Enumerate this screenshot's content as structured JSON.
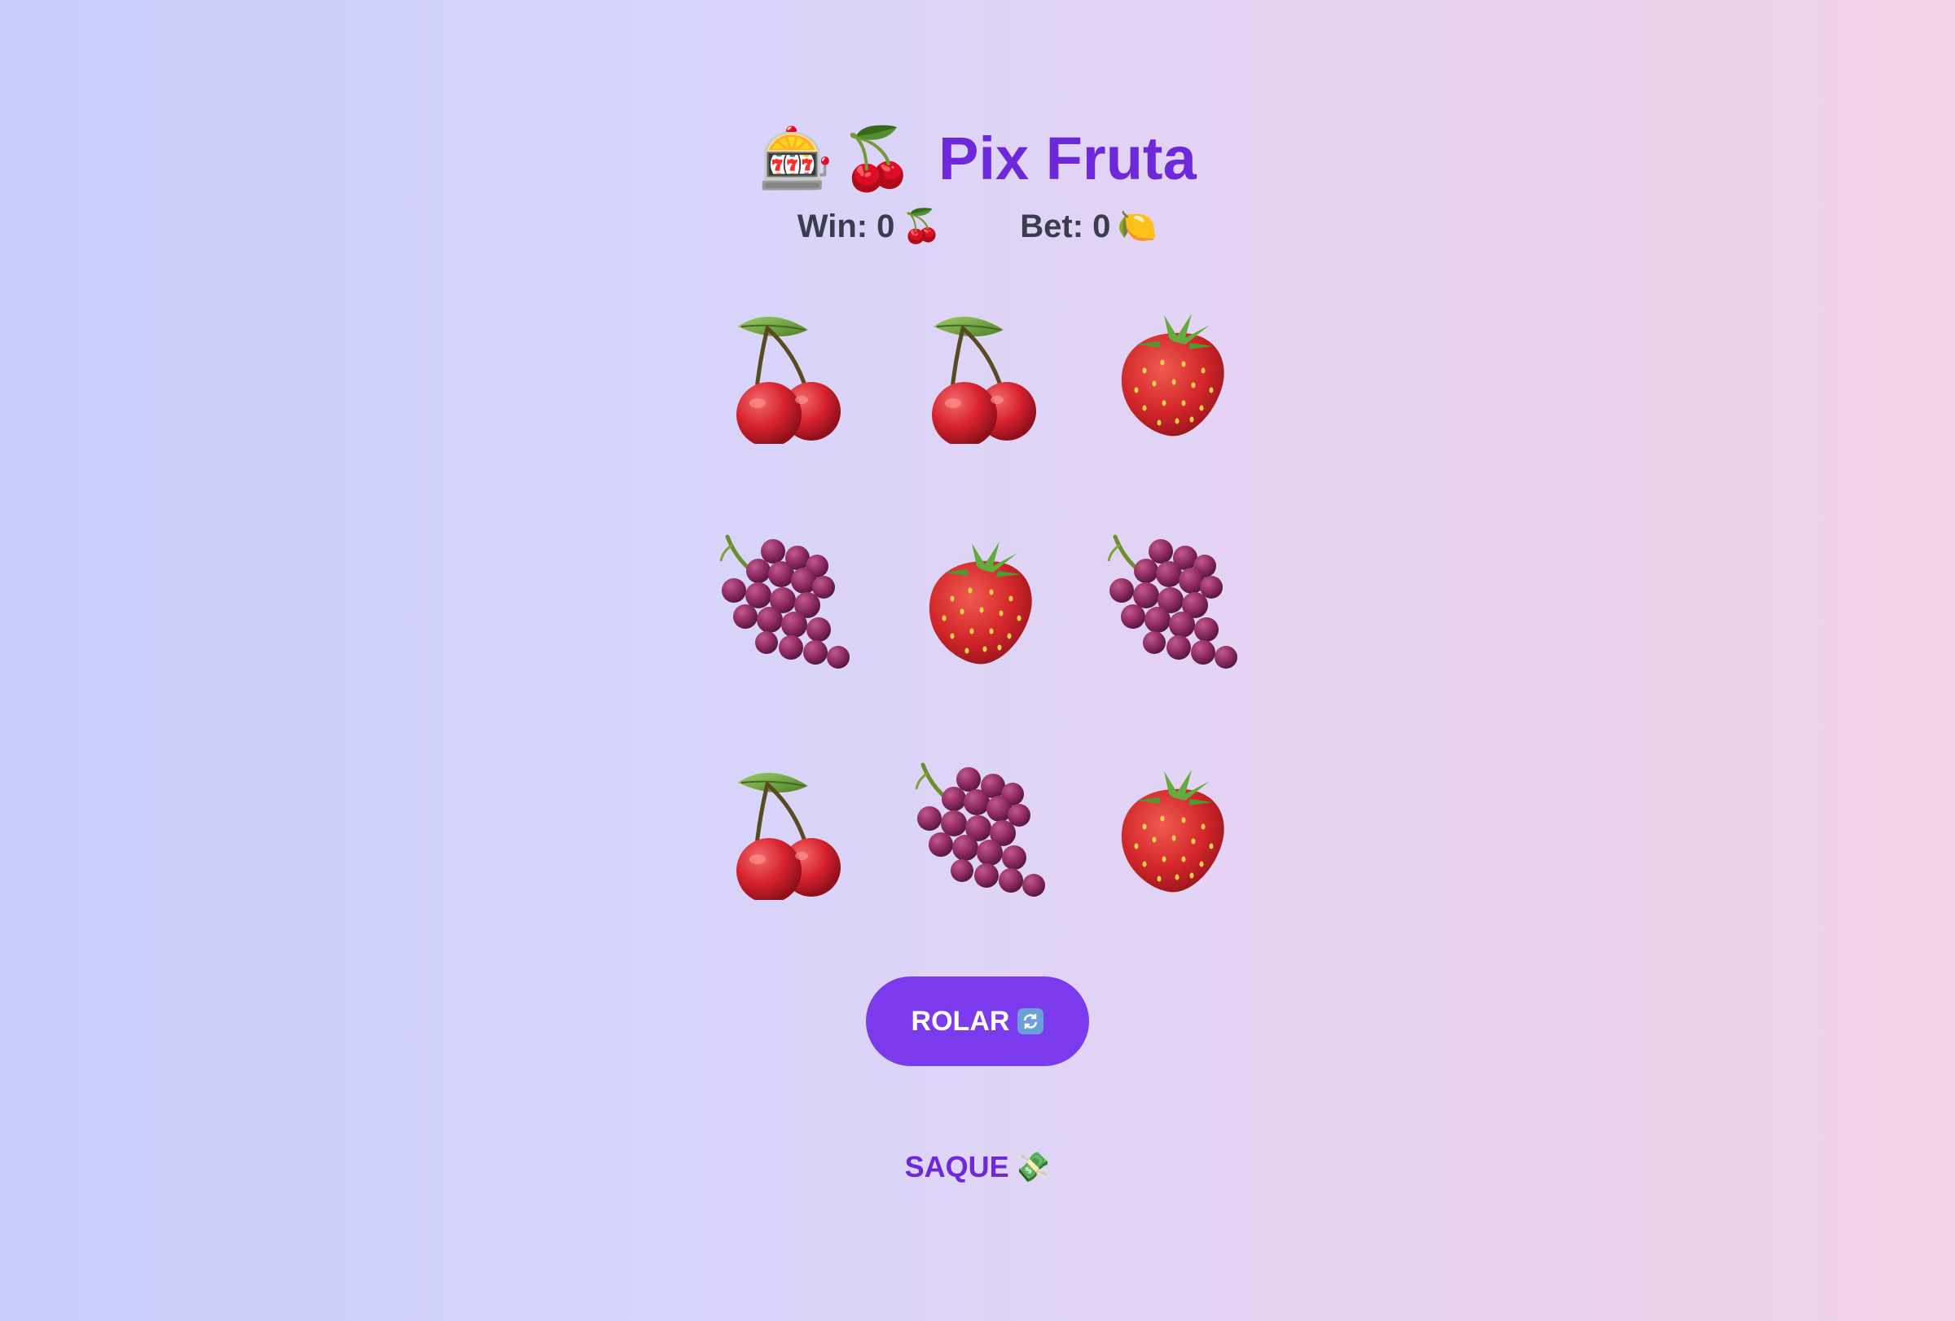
{
  "title": {
    "icon_slot": "🎰",
    "icon_cherry": "🍒",
    "text": "Pix Fruta"
  },
  "stats": {
    "win_label": "Win: 0",
    "win_icon": "🍒",
    "bet_label": "Bet: 0",
    "bet_icon": "🍋"
  },
  "reels": [
    [
      "cherry",
      "cherry",
      "strawberry"
    ],
    [
      "grapes",
      "strawberry",
      "grapes"
    ],
    [
      "cherry",
      "grapes",
      "strawberry"
    ]
  ],
  "spin_button": {
    "label": "ROLAR",
    "icon": "refresh-icon"
  },
  "withdraw": {
    "label": "SAQUE",
    "icon": "💸"
  },
  "colors": {
    "accent": "#7c3aed",
    "title": "#6d28d9",
    "stats_text": "#3a3d4d"
  }
}
